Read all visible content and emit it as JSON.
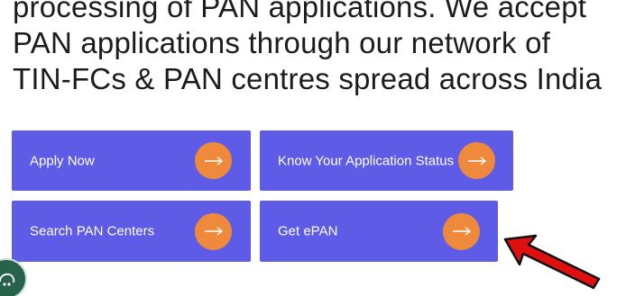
{
  "intro": {
    "lines": [
      "processing of PAN applications. We accept",
      "PAN applications through our network of",
      "TIN-FCs & PAN centres spread across India"
    ]
  },
  "buttons": [
    {
      "label": "Apply Now",
      "icon": "arrow-right-icon"
    },
    {
      "label": "Know Your Application Status",
      "icon": "arrow-right-icon"
    },
    {
      "label": "Search PAN Centers",
      "icon": "arrow-right-icon"
    },
    {
      "label": "Get ePAN",
      "icon": "arrow-right-icon"
    }
  ],
  "colors": {
    "button_bg": "#5e5ce6",
    "arrow_circle": "#ef8a3c",
    "annotation_arrow": "#e01010",
    "chat_bubble": "#27624a"
  },
  "icons": {
    "chat": "chat-widget-icon",
    "annotation": "red-pointer-arrow-icon"
  }
}
